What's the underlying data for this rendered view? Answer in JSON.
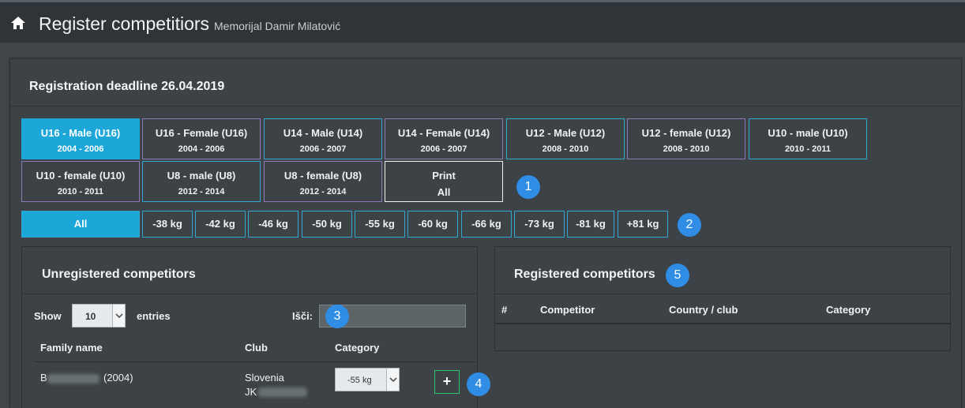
{
  "header": {
    "title": "Register competitiors",
    "subtitle": "Memorijal Damir Milatović",
    "icon": "home-icon"
  },
  "deadline": "Registration deadline 26.04.2019",
  "categories": [
    {
      "name": "U16 - Male (U16)",
      "years": "2004 - 2006"
    },
    {
      "name": "U16 - Female (U16)",
      "years": "2004 - 2006"
    },
    {
      "name": "U14 - Male (U14)",
      "years": "2006 - 2007"
    },
    {
      "name": "U14 - Female (U14)",
      "years": "2006 - 2007"
    },
    {
      "name": "U12 - Male (U12)",
      "years": "2008 - 2010"
    },
    {
      "name": "U12 - female (U12)",
      "years": "2008 - 2010"
    },
    {
      "name": "U10 - male (U10)",
      "years": "2010 - 2011"
    },
    {
      "name": "U10 - female (U10)",
      "years": "2010 - 2011"
    },
    {
      "name": "U8 - male (U8)",
      "years": "2012 - 2014"
    },
    {
      "name": "U8 - female (U8)",
      "years": "2012 - 2014"
    },
    {
      "name": "Print",
      "years": "All"
    }
  ],
  "weights": [
    "All",
    "-38 kg",
    "-42 kg",
    "-46 kg",
    "-50 kg",
    "-55 kg",
    "-60 kg",
    "-66 kg",
    "-73 kg",
    "-81 kg",
    "+81 kg"
  ],
  "badges": [
    "1",
    "2",
    "3",
    "4",
    "5"
  ],
  "unregistered": {
    "title": "Unregistered competitors",
    "show_label": "Show",
    "entries_value": "10",
    "entries_label": "entries",
    "search_label": "Išči:",
    "search_value": "",
    "columns": [
      "Family name",
      "Club",
      "Category"
    ],
    "row": {
      "name_prefix": "B",
      "name_suffix": "(2004)",
      "country": "Slovenia",
      "club_prefix": "JK",
      "category": "-55 kg",
      "add_label": "+"
    }
  },
  "registered": {
    "title": "Registered competitors",
    "columns": [
      "#",
      "Competitor",
      "Country / club",
      "Category"
    ]
  },
  "colors": {
    "accent": "#1da6d8",
    "badge": "#2f8de6",
    "add_border": "#2fbf71"
  }
}
